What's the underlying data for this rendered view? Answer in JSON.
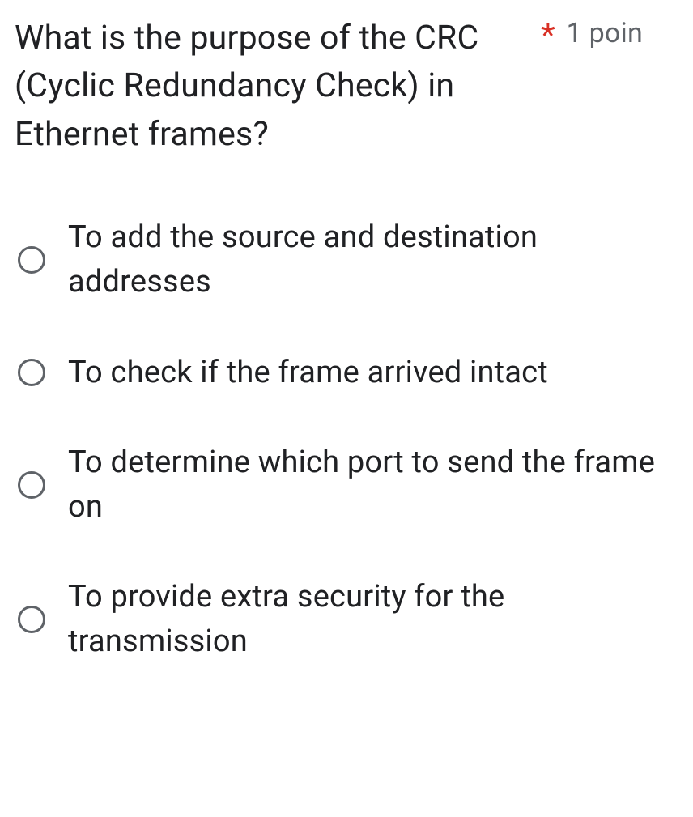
{
  "question": {
    "text": "What is the purpose of the CRC (Cyclic Redundancy Check) in Ethernet frames?",
    "required_marker": "*",
    "points_label": "1 poin"
  },
  "options": [
    {
      "label": "To add the source and destination addresses"
    },
    {
      "label": "To check if the frame arrived intact"
    },
    {
      "label": "To determine which port to send the frame on"
    },
    {
      "label": "To provide extra security for the transmission"
    }
  ]
}
